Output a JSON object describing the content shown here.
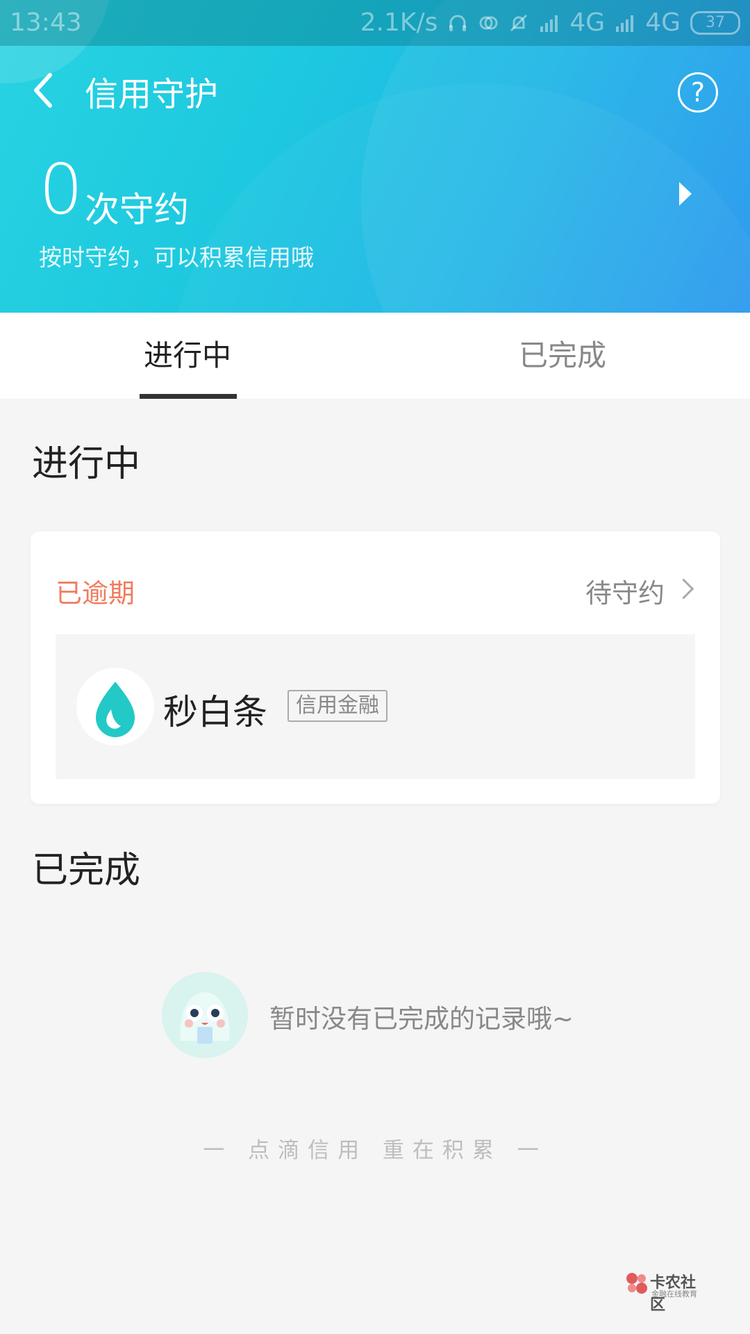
{
  "status_bar": {
    "time": "13:43",
    "speed": "2.1K/s",
    "network1": "4G",
    "network2": "4G",
    "battery": "37"
  },
  "header": {
    "title": "信用守护"
  },
  "summary": {
    "count": "0",
    "unit": "次守约",
    "subtitle": "按时守约，可以积累信用哦"
  },
  "tabs": [
    {
      "label": "进行中",
      "active": true
    },
    {
      "label": "已完成",
      "active": false
    }
  ],
  "sections": {
    "in_progress_title": "进行中",
    "done_title": "已完成"
  },
  "card": {
    "status": "已逾期",
    "action": "待守约",
    "product_name": "秒白条",
    "product_tag": "信用金融"
  },
  "empty": {
    "text": "暂时没有已完成的记录哦~"
  },
  "slogan": "一 点滴信用 重在积累 一",
  "watermark": {
    "main": "卡农社区",
    "sub": "金融在线教育"
  },
  "colors": {
    "accent_start": "#28d3e2",
    "accent_end": "#2395ee",
    "overdue": "#f07c5f",
    "product_icon": "#22c9c6"
  }
}
